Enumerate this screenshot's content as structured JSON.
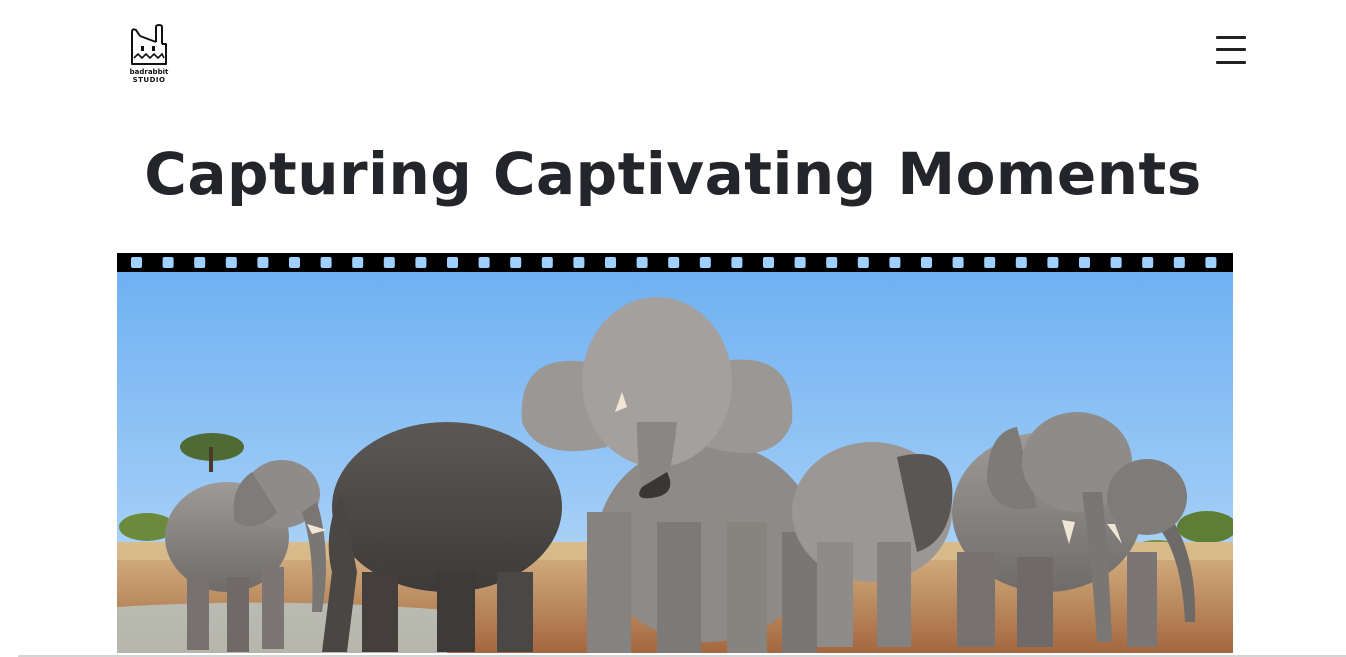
{
  "header": {
    "logo": {
      "line1": "badrabbit",
      "line2": "STUDIO",
      "icon": "rabbit-logo-icon"
    },
    "menu_icon": "hamburger-menu-icon"
  },
  "hero": {
    "title": "Capturing Captivating Moments",
    "image": {
      "subject": "elephant-herd-photo",
      "frame": "film-strip"
    }
  },
  "colors": {
    "title": "#23252b",
    "film_strip": "#000000",
    "sprocket_hole": "#9fd0ff",
    "sky": "#7fbaf0",
    "ground": "#c89b6a"
  }
}
